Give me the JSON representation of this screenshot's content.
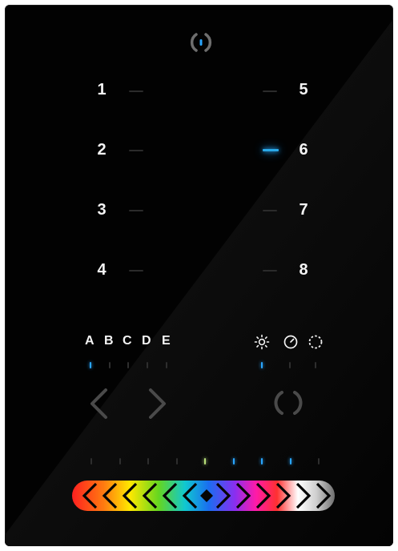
{
  "zones_left": [
    "1",
    "2",
    "3",
    "4"
  ],
  "zones_right": [
    "5",
    "6",
    "7",
    "8"
  ],
  "active_zone": "6",
  "scenes": [
    "A",
    "B",
    "C",
    "D",
    "E"
  ],
  "active_scene": "A",
  "modes": [
    {
      "icon": "sun-icon"
    },
    {
      "icon": "clock-icon"
    },
    {
      "icon": "dotted-circle-icon"
    }
  ],
  "active_mode": "sun-icon",
  "buttons": {
    "power": "power-icon",
    "prev": "chevron-left-icon",
    "next": "chevron-right-icon",
    "cycle": "refresh-icon"
  },
  "colors": {
    "accent": "#29a9e8",
    "green_led": "#b9e07a",
    "text": "#f4f4f4",
    "panel": "#020202"
  },
  "color_slider_leds": [
    "off",
    "off",
    "off",
    "off",
    "green",
    "blue",
    "blue",
    "blue",
    "off"
  ]
}
